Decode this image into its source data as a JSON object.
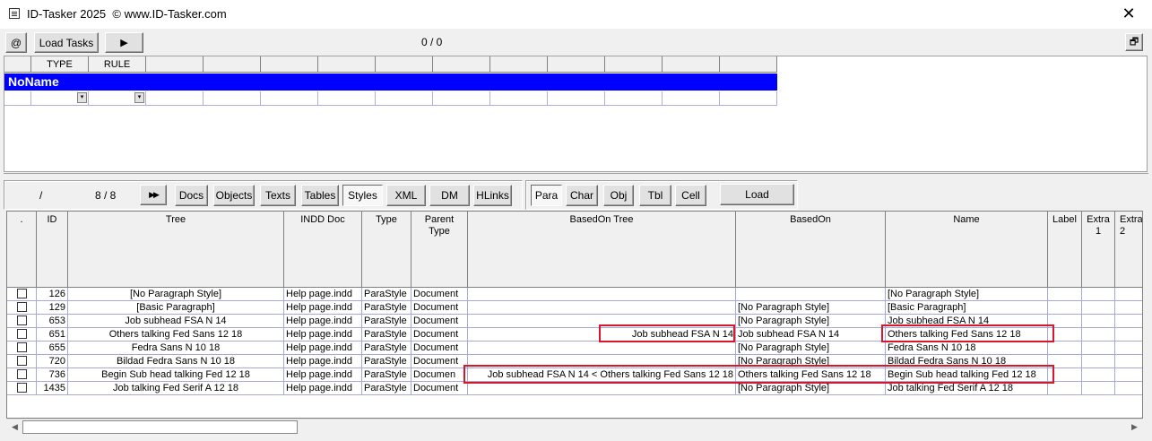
{
  "window": {
    "title": "ID-Tasker 2025  © www.ID-Tasker.com",
    "close_symbol": "✕"
  },
  "toolbar1": {
    "at_label": "@",
    "load_tasks_label": "Load Tasks",
    "play_symbol": "▶",
    "counter": "0 / 0",
    "restore_symbol": "🗗"
  },
  "task_grid": {
    "headers": [
      "",
      "TYPE",
      "RULE",
      "",
      "",
      "",
      "",
      "",
      "",
      "",
      "",
      "",
      ""
    ],
    "noname": "NoName",
    "dropdown_symbol": "▾"
  },
  "toolbar2": {
    "slash": "/",
    "count": "8 / 8",
    "fast_forward_symbol": "▶▶",
    "tabs": [
      "Docs",
      "Objects",
      "Texts",
      "Tables",
      "Styles",
      "XML",
      "DM",
      "HLinks"
    ],
    "active_tab": "Styles",
    "sub_tabs": [
      "Para",
      "Char",
      "Obj",
      "Tbl",
      "Cell"
    ],
    "active_sub_tab": "Para",
    "load_label": "Load"
  },
  "table": {
    "columns": [
      ".",
      "ID",
      "Tree",
      "INDD Doc",
      "Type",
      "Parent\nType",
      "BasedOn Tree",
      "BasedOn",
      "Name",
      "Label",
      "Extra\n1",
      "Extra\n2"
    ],
    "rows": [
      {
        "id": "126",
        "tree": "[No Paragraph Style]",
        "doc": "Help page.indd",
        "type": "ParaStyle",
        "parent": "Document",
        "based_tree": "",
        "based_on": "",
        "name": "[No Paragraph Style]"
      },
      {
        "id": "129",
        "tree": "[Basic Paragraph]",
        "doc": "Help page.indd",
        "type": "ParaStyle",
        "parent": "Document",
        "based_tree": "",
        "based_on": "[No Paragraph Style]",
        "name": "[Basic Paragraph]"
      },
      {
        "id": "653",
        "tree": "Job subhead FSA N 14",
        "doc": "Help page.indd",
        "type": "ParaStyle",
        "parent": "Document",
        "based_tree": "",
        "based_on": "[No Paragraph Style]",
        "name": "Job subhead FSA N 14"
      },
      {
        "id": "651",
        "tree": "Others talking Fed Sans 12 18",
        "doc": "Help page.indd",
        "type": "ParaStyle",
        "parent": "Document",
        "based_tree": "Job subhead FSA N 14",
        "based_on": "Job subhead FSA N 14",
        "name": "Others talking Fed Sans 12 18"
      },
      {
        "id": "655",
        "tree": "Fedra Sans N 10 18",
        "doc": "Help page.indd",
        "type": "ParaStyle",
        "parent": "Document",
        "based_tree": "",
        "based_on": "[No Paragraph Style]",
        "name": "Fedra Sans N 10 18"
      },
      {
        "id": "720",
        "tree": "Bildad Fedra Sans N 10 18",
        "doc": "Help page.indd",
        "type": "ParaStyle",
        "parent": "Document",
        "based_tree": "",
        "based_on": "[No Paragraph Style]",
        "name": "Bildad Fedra Sans N 10 18"
      },
      {
        "id": "736",
        "tree": "Begin Sub head talking Fed 12 18",
        "doc": "Help page.indd",
        "type": "ParaStyle",
        "parent": "Documen",
        "based_tree": "Job subhead FSA N 14 < Others talking Fed Sans 12 18",
        "based_on": "Others talking Fed Sans 12 18",
        "name": "Begin Sub head talking Fed 12 18"
      },
      {
        "id": "1435",
        "tree": "Job talking Fed Serif A 12 18",
        "doc": "Help page.indd",
        "type": "ParaStyle",
        "parent": "Document",
        "based_tree": "",
        "based_on": "[No Paragraph Style]",
        "name": "Job talking Fed Serif A 12 18"
      }
    ]
  },
  "scrollbar": {
    "left_symbol": "◀",
    "right_symbol": "▶"
  },
  "colors": {
    "noname_bar": "#0000ff",
    "highlight": "#d6182b"
  }
}
